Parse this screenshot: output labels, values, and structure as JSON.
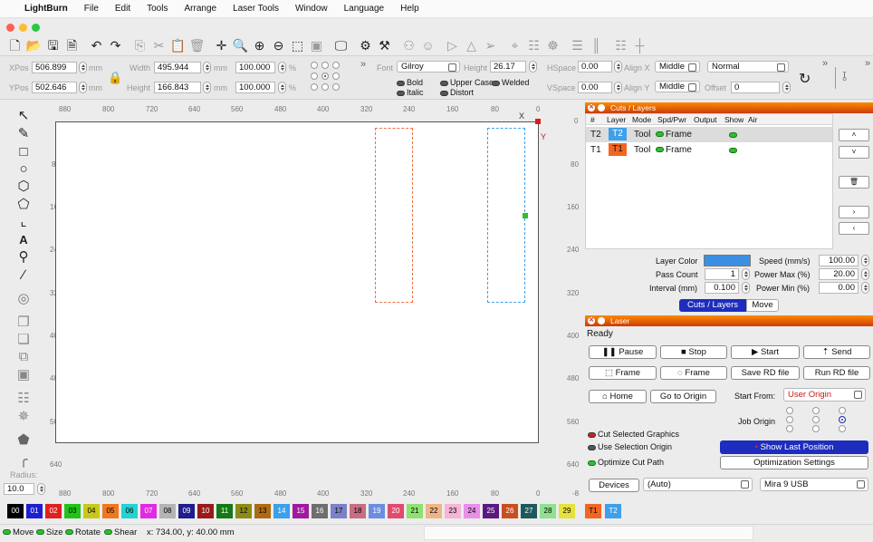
{
  "menu": [
    "LightBurn",
    "File",
    "Edit",
    "Tools",
    "Arrange",
    "Laser Tools",
    "Window",
    "Language",
    "Help"
  ],
  "toolbar_icons": [
    "new-file-icon",
    "open-folder-icon",
    "save-icon",
    "save-as-icon",
    "undo-icon",
    "redo-icon",
    "copy-icon",
    "cut-icon",
    "paste-icon",
    "delete-icon",
    "move-icon",
    "zoom-icon",
    "zoom-in-icon",
    "zoom-out-icon",
    "frame-select-icon",
    "camera-icon",
    "monitor-icon",
    "settings-gear-icon",
    "tools-icon",
    "group-icon",
    "ungroup-icon",
    "mirror-h-icon",
    "mirror-v-icon",
    "rotate-icon",
    "center-icon",
    "align-icon",
    "align2-icon",
    "distribute-icon",
    "distribute2-icon",
    "dock-icon",
    "dock2-icon"
  ],
  "props": {
    "xpos_label": "XPos",
    "xpos_value": "506.899",
    "ypos_label": "YPos",
    "ypos_value": "502.646",
    "mm": "mm",
    "width_label": "Width",
    "width_value": "495.944",
    "height_label": "Height",
    "height_value": "166.843",
    "scale_w": "100.000",
    "scale_h": "100.000",
    "pct": "%",
    "font_label": "Font",
    "font_value": "Gilroy",
    "fheight_label": "Height",
    "fheight_value": "26.17",
    "hspace_label": "HSpace",
    "hspace_value": "0.00",
    "vspace_label": "VSpace",
    "vspace_value": "0.00",
    "alignx_label": "Align X",
    "alignx_value": "Middle",
    "aligny_label": "Align Y",
    "aligny_value": "Middle",
    "normal_value": "Normal",
    "offset_label": "Offset",
    "offset_value": "0",
    "bold": "Bold",
    "italic": "Italic",
    "uppercase": "Upper Case",
    "welded": "Welded",
    "distort": "Distort"
  },
  "left_tools": [
    "select-arrow-icon",
    "pen-icon",
    "rectangle-icon",
    "ellipse-icon",
    "polygon-icon",
    "pentagon-icon",
    "corner-icon",
    "text-icon",
    "position-pin-icon",
    "measure-ruler-icon",
    "offset-icon",
    "boolean-union-icon",
    "boolean-subtract-icon",
    "boolean-intersect-icon",
    "weld-icon",
    "grid-array-icon",
    "circular-array-icon",
    "node-edit-icon",
    "corner-radius-icon"
  ],
  "radius_label": "Radius:",
  "radius_value": "10.0",
  "ruler_top": [
    "880",
    "800",
    "720",
    "640",
    "560",
    "480",
    "400",
    "320",
    "240",
    "160",
    "80",
    "0"
  ],
  "ruler_left": [
    "80",
    "160",
    "240",
    "320",
    "400",
    "480",
    "560",
    "640"
  ],
  "ruler_right": [
    "0",
    "80",
    "160",
    "240",
    "320",
    "400",
    "480",
    "560",
    "640",
    "-8"
  ],
  "axis_x": "X",
  "axis_y": "Y",
  "cuts": {
    "title": "Cuts / Layers",
    "headers": [
      "#",
      "Layer",
      "Mode",
      "Spd/Pwr",
      "Output",
      "Show",
      "Air"
    ],
    "rows": [
      {
        "num": "T2",
        "layer": "T2",
        "color": "#3ea0ea",
        "mode": "Tool",
        "out": "Frame"
      },
      {
        "num": "T1",
        "layer": "T1",
        "color": "#f26522",
        "mode": "Tool",
        "out": "Frame"
      }
    ],
    "layer_color_label": "Layer Color",
    "layer_color": "#3c8fe0",
    "speed_label": "Speed (mm/s)",
    "speed_value": "100.00",
    "pass_label": "Pass Count",
    "pass_value": "1",
    "pmax_label": "Power Max (%)",
    "pmax_value": "20.00",
    "interval_label": "Interval (mm)",
    "interval_value": "0.100",
    "pmin_label": "Power Min (%)",
    "pmin_value": "0.00",
    "tab_cuts": "Cuts / Layers",
    "tab_move": "Move"
  },
  "laser": {
    "title": "Laser",
    "status": "Ready",
    "pause": "Pause",
    "stop": "Stop",
    "start": "Start",
    "send": "Send",
    "frame1": "Frame",
    "frame2": "Frame",
    "save_rd": "Save RD file",
    "run_rd": "Run RD file",
    "home": "Home",
    "goto_origin": "Go to Origin",
    "start_from_label": "Start From:",
    "start_from": "User Origin",
    "job_origin": "Job Origin",
    "cut_selected": "Cut Selected Graphics",
    "use_selection": "Use Selection Origin",
    "optimize": "Optimize Cut Path",
    "show_last": "Show Last Position",
    "opt_settings": "Optimization Settings",
    "devices": "Devices",
    "auto": "(Auto)",
    "device": "Mira 9 USB"
  },
  "palette": [
    {
      "l": "00",
      "c": "#000000",
      "t": "#fff"
    },
    {
      "l": "01",
      "c": "#1f1fd0",
      "t": "#fff"
    },
    {
      "l": "02",
      "c": "#e02020",
      "t": "#fff"
    },
    {
      "l": "03",
      "c": "#22c41a",
      "t": "#000"
    },
    {
      "l": "04",
      "c": "#c8c81a",
      "t": "#000"
    },
    {
      "l": "05",
      "c": "#f07820",
      "t": "#000"
    },
    {
      "l": "06",
      "c": "#26d2d2",
      "t": "#000"
    },
    {
      "l": "07",
      "c": "#e22ae2",
      "t": "#fff"
    },
    {
      "l": "08",
      "c": "#b4b4b4",
      "t": "#000"
    },
    {
      "l": "09",
      "c": "#1e1e8c",
      "t": "#fff"
    },
    {
      "l": "10",
      "c": "#9a1a1a",
      "t": "#fff"
    },
    {
      "l": "11",
      "c": "#147a14",
      "t": "#fff"
    },
    {
      "l": "12",
      "c": "#8c8c14",
      "t": "#000"
    },
    {
      "l": "13",
      "c": "#b06a14",
      "t": "#000"
    },
    {
      "l": "14",
      "c": "#3aa0e8",
      "t": "#fff"
    },
    {
      "l": "15",
      "c": "#a01aa0",
      "t": "#fff"
    },
    {
      "l": "16",
      "c": "#6e6e6e",
      "t": "#fff"
    },
    {
      "l": "17",
      "c": "#7a82c8",
      "t": "#000"
    },
    {
      "l": "18",
      "c": "#c86e82",
      "t": "#000"
    },
    {
      "l": "19",
      "c": "#6c8ee0",
      "t": "#fff"
    },
    {
      "l": "20",
      "c": "#e24a70",
      "t": "#fff"
    },
    {
      "l": "21",
      "c": "#8ee26e",
      "t": "#000"
    },
    {
      "l": "22",
      "c": "#f0b488",
      "t": "#000"
    },
    {
      "l": "23",
      "c": "#f5b4d8",
      "t": "#000"
    },
    {
      "l": "24",
      "c": "#e890e8",
      "t": "#000"
    },
    {
      "l": "25",
      "c": "#5a1a82",
      "t": "#fff"
    },
    {
      "l": "26",
      "c": "#c8501e",
      "t": "#fff"
    },
    {
      "l": "27",
      "c": "#1e5a5a",
      "t": "#fff"
    },
    {
      "l": "28",
      "c": "#90e090",
      "t": "#000"
    },
    {
      "l": "29",
      "c": "#e8e03c",
      "t": "#000"
    },
    {
      "l": "T1",
      "c": "#f26522",
      "t": "#000"
    },
    {
      "l": "T2",
      "c": "#3ea0ea",
      "t": "#fff"
    }
  ],
  "status": {
    "move": "Move",
    "size": "Size",
    "rotate": "Rotate",
    "shear": "Shear",
    "coords": "x: 734.00, y: 40.00 mm"
  }
}
